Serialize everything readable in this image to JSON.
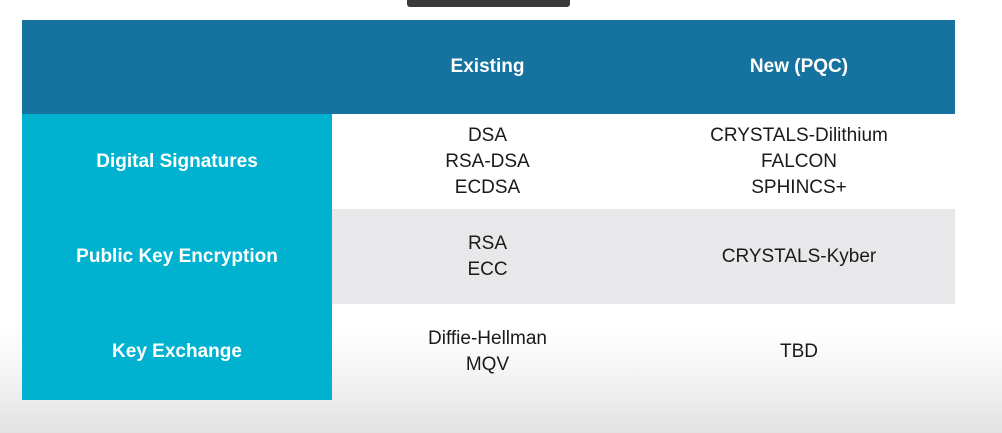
{
  "table": {
    "header": {
      "corner": "",
      "existing": "Existing",
      "new": "New (PQC)"
    },
    "rows": [
      {
        "label": "Digital Signatures",
        "existing": [
          "DSA",
          "RSA-DSA",
          "ECDSA"
        ],
        "new": [
          "CRYSTALS-Dilithium",
          "FALCON",
          "SPHINCS+"
        ]
      },
      {
        "label": "Public Key Encryption",
        "existing": [
          "RSA",
          "ECC"
        ],
        "new": [
          "CRYSTALS-Kyber"
        ]
      },
      {
        "label": "Key Exchange",
        "existing": [
          "Diffie-Hellman",
          "MQV"
        ],
        "new": [
          "TBD"
        ]
      }
    ]
  },
  "colors": {
    "header_bg": "#16729e",
    "label_bg": "#00b2cf",
    "alt_row_bg": "#e8e8ea"
  }
}
